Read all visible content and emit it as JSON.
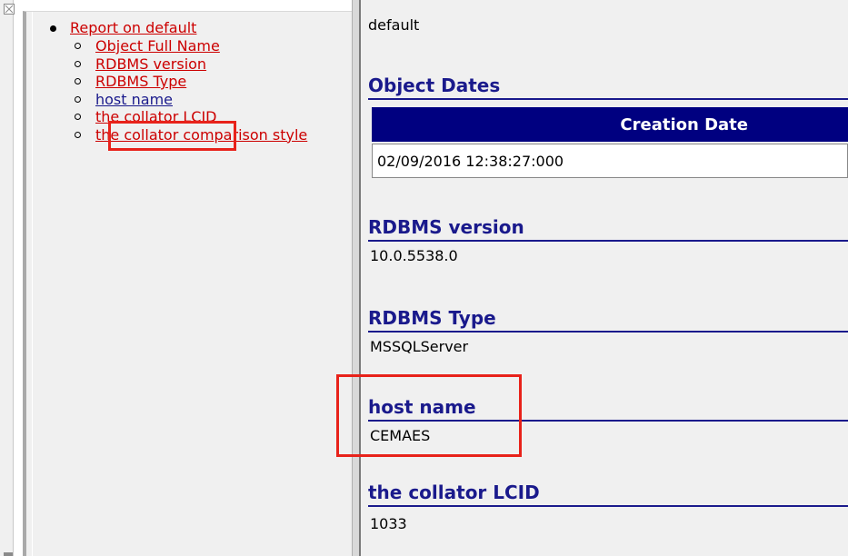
{
  "toc": {
    "top_item": "Report on default",
    "items": [
      {
        "label": "Object Full Name"
      },
      {
        "label": "RDBMS version"
      },
      {
        "label": "RDBMS Type"
      },
      {
        "label": "host name"
      },
      {
        "label": "the collator LCID"
      },
      {
        "label": "the collator comparison style"
      }
    ]
  },
  "content": {
    "object_name": "default",
    "object_dates": {
      "title": "Object Dates",
      "column_header": "Creation Date",
      "creation_date": "02/09/2016 12:38:27:000"
    },
    "rdbms_version": {
      "title": "RDBMS version",
      "value": "10.0.5538.0"
    },
    "rdbms_type": {
      "title": "RDBMS Type",
      "value": "MSSQLServer"
    },
    "host_name": {
      "title": "host name",
      "value": "CEMAES"
    },
    "collator_lcid": {
      "title": "the collator LCID",
      "value": "1033"
    }
  },
  "icons": {
    "close": "close-icon"
  },
  "colors": {
    "link": "#cc0000",
    "heading": "#1a1a8c",
    "table_header_bg": "#000080",
    "highlight": "#e8221a"
  }
}
